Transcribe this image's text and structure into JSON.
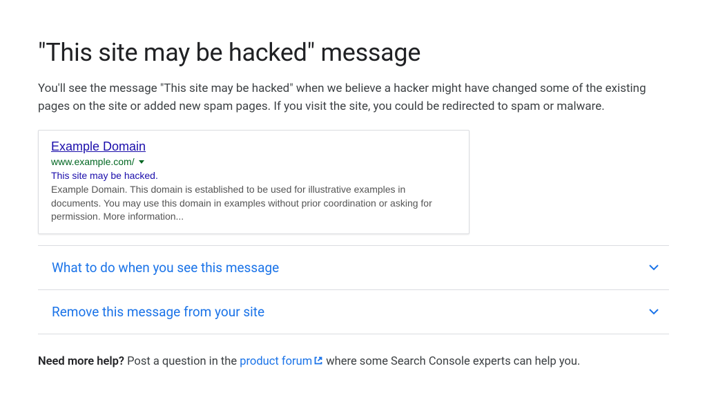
{
  "page": {
    "title": "\"This site may be hacked\" message",
    "intro": "You'll see the message \"This site may be hacked\" when we believe a hacker might have changed some of the existing pages on the site or added new spam pages. If you visit the site, you could be redirected to spam or malware."
  },
  "search_result": {
    "title": "Example Domain",
    "url": "www.example.com/",
    "warning": "This site may be hacked.",
    "snippet": "Example Domain. This domain is established to be used for illustrative examples in documents. You may use this domain in examples without prior coordination or asking for permission. More information..."
  },
  "accordion": {
    "items": [
      {
        "title": "What to do when you see this message"
      },
      {
        "title": "Remove this message from your site"
      }
    ]
  },
  "footer": {
    "strong": "Need more help?",
    "before_link": " Post a question in the ",
    "link": "product forum",
    "after_link": "  where some Search Console experts can help you."
  }
}
